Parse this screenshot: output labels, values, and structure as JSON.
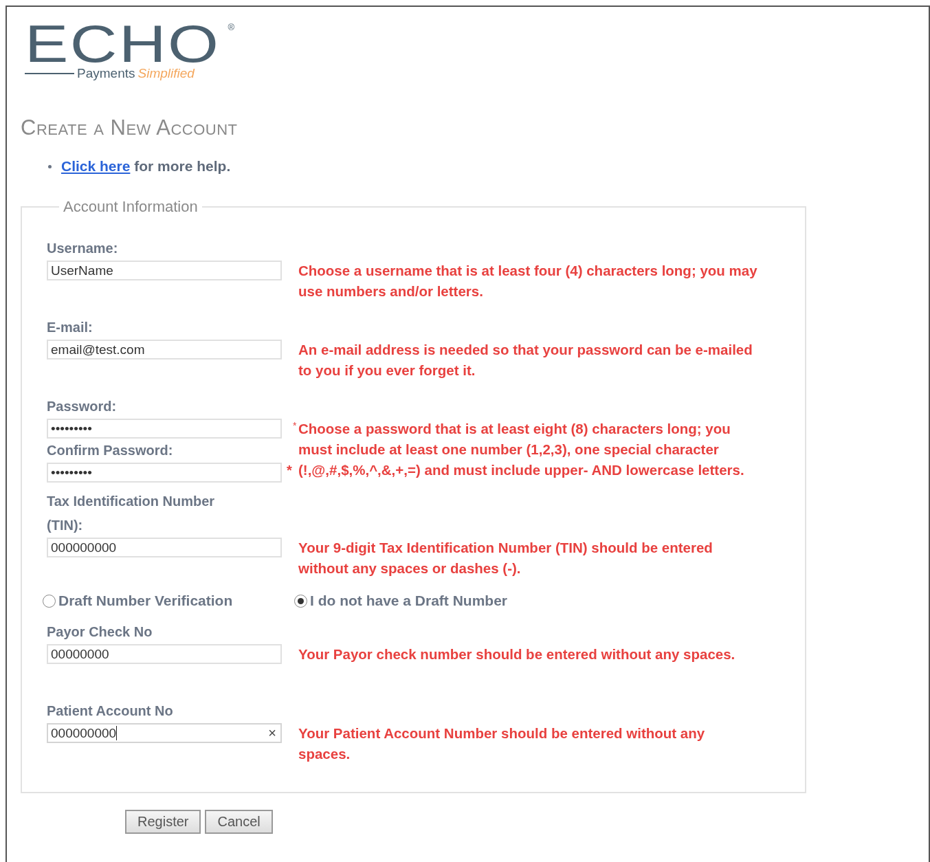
{
  "logo": {
    "wordmark": "ECHO",
    "registered": "®",
    "tagline": "Payments",
    "tagline_accent": "Simplified"
  },
  "title": "Create a New Account",
  "help": {
    "link": "Click here",
    "text": "for more help."
  },
  "fieldset": {
    "legend": "Account Information",
    "groups": [
      {
        "kind": "single",
        "fields": [
          {
            "label": "Username:",
            "value": "UserName"
          }
        ],
        "hint": "Choose a username that is at least four (4) characters long; you may use numbers and/or letters."
      },
      {
        "kind": "single",
        "fields": [
          {
            "label": "E-mail:",
            "value": "email@test.com"
          }
        ],
        "hint": "An e-mail address is needed so that your password can be e-mailed to you if you ever forget it."
      },
      {
        "kind": "pair",
        "fields": [
          {
            "label": "Password:",
            "value": "•••••••••"
          },
          {
            "label": "Confirm Password:",
            "value": "•••••••••",
            "required_mark": "*"
          }
        ],
        "hint_mark": "*",
        "hint": "Choose a password that is at least eight (8) characters long; you must include at least one number (1,2,3), one special character (!,@,#,$,%,^,&,+,=) and must include upper- AND lowercase letters."
      },
      {
        "kind": "single",
        "fields": [
          {
            "label": "Tax Identification Number (TIN):",
            "value": "000000000"
          }
        ],
        "hint": "Your 9-digit Tax Identification Number (TIN) should be entered without any spaces or dashes (-)."
      },
      {
        "kind": "radios",
        "options": [
          {
            "label": "Draft Number Verification",
            "selected": false
          },
          {
            "label": "I do not have a Draft Number",
            "selected": true
          }
        ]
      },
      {
        "kind": "single",
        "fields": [
          {
            "label": "Payor Check No",
            "value": "00000000"
          }
        ],
        "hint": "Your Payor check number should be entered without any spaces."
      },
      {
        "kind": "single",
        "fields": [
          {
            "label": "Patient Account No",
            "value": "000000000",
            "clear": "×",
            "focused": true
          }
        ],
        "hint": "Your Patient Account Number should be entered without any spaces."
      }
    ]
  },
  "buttons": [
    "Register",
    "Cancel"
  ]
}
